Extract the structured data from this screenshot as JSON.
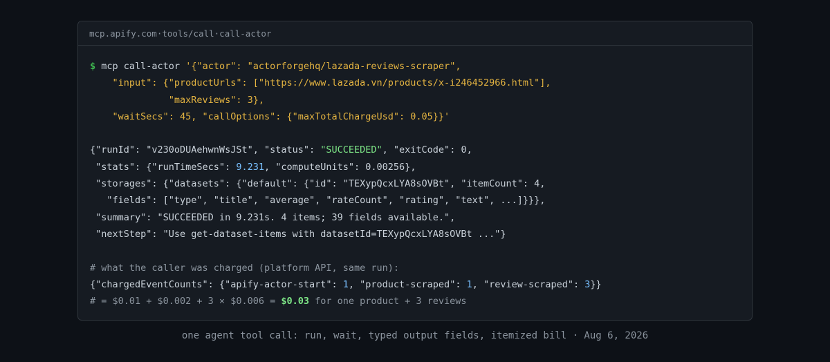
{
  "window": {
    "header": {
      "host": "mcp.apify.com",
      "sep1": " · ",
      "method": "tools/call",
      "sep2": " · ",
      "tool": "call-actor"
    }
  },
  "command": {
    "prompt": "$",
    "name": " mcp call-actor ",
    "arg_line1": "'{\"actor\": \"actorforgehq/lazada-reviews-scraper\",",
    "arg_line2": "    \"input\": {\"productUrls\": [\"https://www.lazada.vn/products/x-i246452966.html\"],",
    "arg_line3": "              \"maxReviews\": 3},",
    "arg_line4": "    \"waitSecs\": 45, \"callOptions\": {\"maxTotalChargeUsd\": 0.05}}'"
  },
  "response": {
    "l1_pre": "{\"runId\": \"v230oDUAehwnWsJSt\", \"status\": ",
    "status": "\"SUCCEEDED\"",
    "l1_mid": ", \"exitCode\": ",
    "exit_code": "0",
    "l1_post": ",",
    "l2_pre": " \"stats\": {\"runTimeSecs\": ",
    "run_time_secs": "9.231",
    "l2_mid": ", \"computeUnits\": ",
    "compute_units": "0.00256",
    "l2_post": "},",
    "l3_pre": " \"storages\": {\"datasets\": {\"default\": {\"id\": \"TEXypQcxLYA8sOVBt\", \"itemCount\": ",
    "item_count": "4",
    "l3_post": ",",
    "l4": "   \"fields\": [\"type\", \"title\", \"average\", \"rateCount\", \"rating\", \"text\", ...]}}},",
    "l5": " \"summary\": \"SUCCEEDED in 9.231s. 4 items; 39 fields available.\",",
    "l6": " \"nextStep\": \"Use get-dataset-items with datasetId=TEXypQcxLYA8sOVBt ...\"}"
  },
  "charges": {
    "comment": "# what the caller was charged (platform API, same run):",
    "c_pre": "{\"chargedEventCounts\": {\"apify-actor-start\": ",
    "actor_start": "1",
    "c_mid1": ", \"product-scraped\": ",
    "product_scraped": "1",
    "c_mid2": ", \"review-scraped\": ",
    "review_scraped": "3",
    "c_post": "}}",
    "total_pre": "# = $0.01 + $0.002 + 3 × $0.006 = ",
    "total": "$0.03",
    "total_post": " for one product + 3 reviews"
  },
  "caption": "one agent tool call: run, wait, typed output fields, itemized bill · Aug 6, 2026"
}
